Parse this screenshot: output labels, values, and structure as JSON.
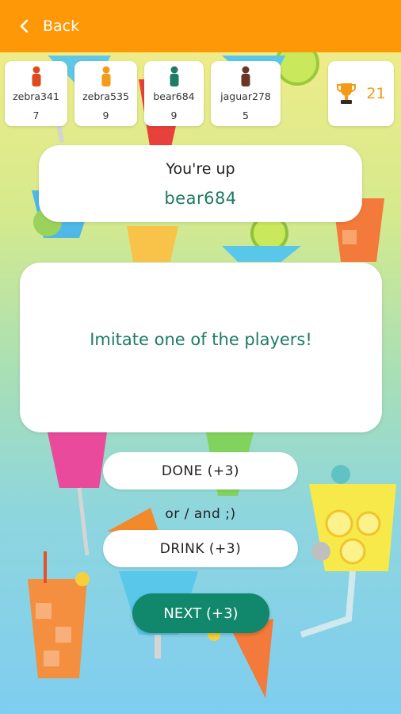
{
  "header": {
    "back_label": "Back",
    "background_color": "#ff9806"
  },
  "players": [
    {
      "name": "zebra341",
      "score": "7",
      "pawn_color": "#e0491f"
    },
    {
      "name": "zebra535",
      "score": "9",
      "pawn_color": "#f59b18"
    },
    {
      "name": "bear684",
      "score": "9",
      "pawn_color": "#1f7a66"
    },
    {
      "name": "jaguar278",
      "score": "5",
      "pawn_color": "#6b3526"
    }
  ],
  "trophy": {
    "count": "21",
    "icon": "trophy-icon",
    "color": "#f39a16"
  },
  "turn": {
    "label": "You're up",
    "player_name": "bear684"
  },
  "task": {
    "text": "Imitate one of the players!"
  },
  "actions": {
    "done_label": "DONE (+3)",
    "or_text": "or / and ;)",
    "drink_label": "DRINK (+3)",
    "next_label": "NEXT (+3)"
  },
  "colors": {
    "accent_green": "#11876b",
    "text_green": "#1e7a63"
  }
}
